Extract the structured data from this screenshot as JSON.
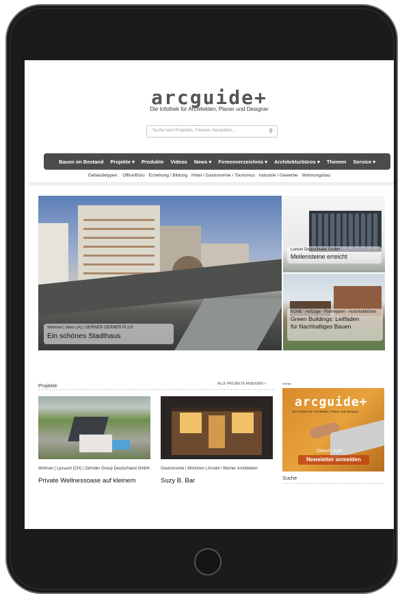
{
  "site": {
    "logo_text": "arcguide+",
    "tagline": "Die Infothek für Architekten, Planer und Designer",
    "search_placeholder": "Suche nach Projekten, Themen, Herstellern...",
    "search_icon": "search-icon"
  },
  "nav": {
    "items": [
      "Bauen im Bestand",
      "Projekte ▾",
      "Produkte",
      "Videos",
      "News ▾",
      "Firmenverzeichnis ▾",
      "Architekturbüros ▾",
      "Themen",
      "Service ▾"
    ]
  },
  "subnav": {
    "label": "Gebäudetypen:",
    "items": [
      "Office/Büro",
      "Erziehung / Bildung",
      "Hotel / Gastronomie / Tourismus",
      "Industrie / Gewerbe",
      "Wohnungsbau"
    ]
  },
  "hero": {
    "main": {
      "meta": "Wohnen | Wien (A) | GERNER GERNER PLUS",
      "title": "Ein schönes Stadthaus"
    },
    "side1": {
      "meta": "Lumon Deutschland GmbH",
      "title": "Meilensteine erreicht"
    },
    "side2": {
      "meta": "KONE - Aufzüge - Rolltreppen - Automatiktüren",
      "title_line1": "Green Buildings: Leitfaden",
      "title_line2": "für Nachhaltiges Bauen"
    }
  },
  "projects": {
    "heading": "Projekte",
    "all_link": "ALLE PROJEKTE ANZEIGEN  >",
    "cards": [
      {
        "meta": "Wohnen | Lyssach (CH) | Zehnder Group Deutschland GmbH",
        "title": "Private Wellnessoase auf kleinem"
      },
      {
        "meta": "Gastronomie | München | Arnold / Werner Architekten",
        "title": "Suzy B. Bar"
      }
    ]
  },
  "sidebar": {
    "ad_label": "Anzeige",
    "ad_logo": "arcguide+",
    "ad_sub": "Die Infothek für Architekten, Planer und Designer",
    "ad_cta_line1": "Gleich zum",
    "ad_cta_line2": "Newsletter anmelden",
    "search_heading": "Suche"
  }
}
